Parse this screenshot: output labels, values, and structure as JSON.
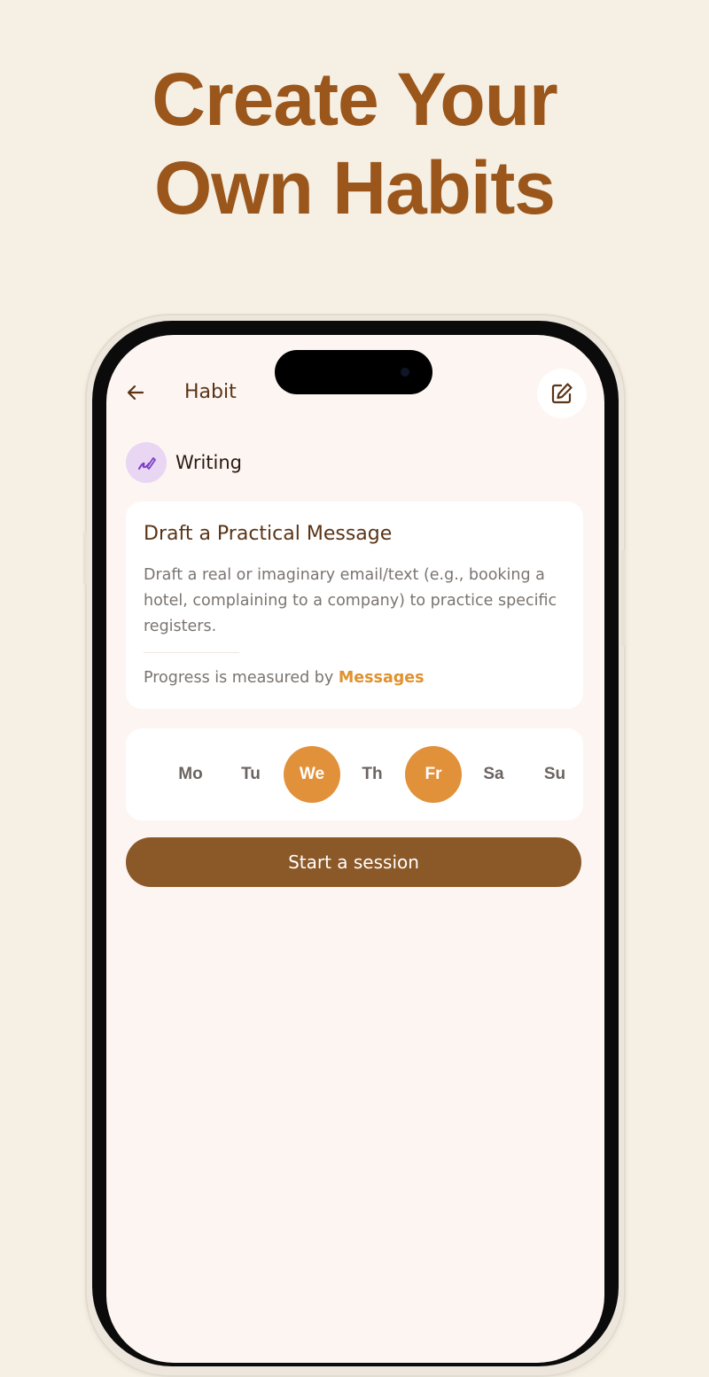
{
  "headline": {
    "line1": "Create Your",
    "line2": "Own Habits"
  },
  "header": {
    "back_icon": "arrow-left-icon",
    "title": "Habit",
    "edit_icon": "edit-square-pencil-icon"
  },
  "category": {
    "icon": "pen-writing-icon",
    "label": "Writing"
  },
  "habit_card": {
    "title": "Draft a Practical Message",
    "description": "Draft a real or imaginary email/text (e.g., booking a hotel, complaining to a company) to practice specific registers.",
    "progress_prefix": "Progress is measured by",
    "progress_metric": "Messages"
  },
  "days": [
    {
      "label": "Mo",
      "selected": false
    },
    {
      "label": "Tu",
      "selected": false
    },
    {
      "label": "We",
      "selected": true
    },
    {
      "label": "Th",
      "selected": false
    },
    {
      "label": "Fr",
      "selected": true
    },
    {
      "label": "Sa",
      "selected": false
    },
    {
      "label": "Su",
      "selected": false
    }
  ],
  "start_button": {
    "label": "Start a session"
  },
  "colors": {
    "background": "#f6efe3",
    "headline": "#9a561b",
    "accent": "#e2913b",
    "primary_button": "#8b5828",
    "screen_bg": "#fdf5f2"
  }
}
